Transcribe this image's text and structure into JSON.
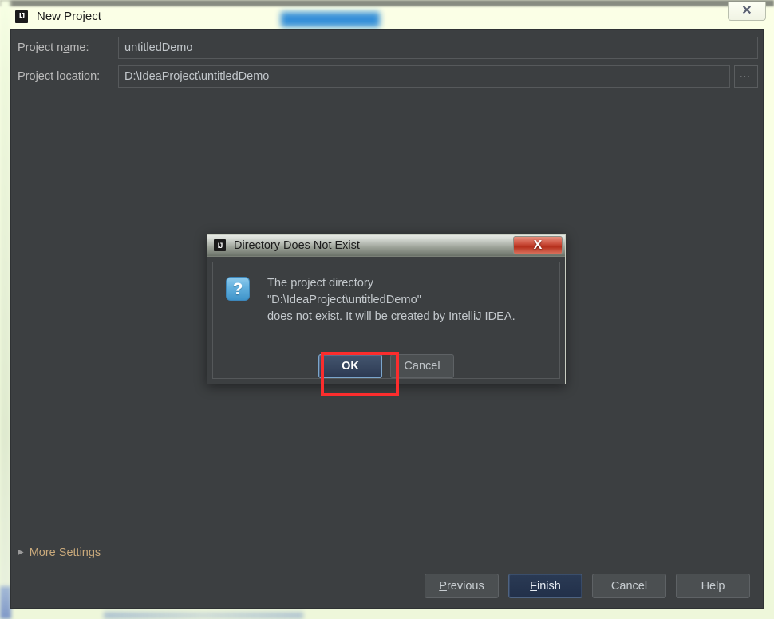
{
  "window": {
    "title": "New Project",
    "app_icon": "IJ",
    "close_icon": "intellij-window-close-icon",
    "close_glyph": "✕"
  },
  "form": {
    "project_name": {
      "label_pre": "Project n",
      "label_mnemonic": "a",
      "label_post": "me:",
      "value": "untitledDemo",
      "placeholder": ""
    },
    "project_location": {
      "label_pre": "Project ",
      "label_mnemonic": "l",
      "label_post": "ocation:",
      "value": "D:\\IdeaProject\\untitledDemo",
      "placeholder": ""
    },
    "browse_button_label": "..."
  },
  "more_settings": {
    "arrow_glyph": "▶",
    "label_pre": "More",
    "label_mnemonic": "",
    "label_post": " Settings",
    "full_label": "More Settings"
  },
  "footer": {
    "previous": {
      "pre": "",
      "mnemonic": "P",
      "post": "revious"
    },
    "finish": {
      "pre": "",
      "mnemonic": "F",
      "post": "inish"
    },
    "cancel": {
      "pre": "Cancel",
      "mnemonic": "",
      "post": ""
    },
    "help": {
      "pre": "Help",
      "mnemonic": "",
      "post": ""
    }
  },
  "dialog": {
    "title": "Directory Does Not Exist",
    "icon": "IJ",
    "close_glyph": "X",
    "message": "The project directory\n\"D:\\IdeaProject\\untitledDemo\"\ndoes not exist. It will be created by IntelliJ IDEA.",
    "ok_label": "OK",
    "cancel_label": "Cancel",
    "question_glyph": "?"
  },
  "colors": {
    "window_background": "#3c3f41",
    "desktop_background": "#fbffe8",
    "text_primary": "#c2c7cb",
    "accent_default_button": "#2a3a54",
    "more_settings_link": "#c9a97b",
    "highlight_annotation": "#fb2d2d",
    "dialog_close_red": "#cf5442",
    "question_icon_blue": "#62b0de"
  }
}
